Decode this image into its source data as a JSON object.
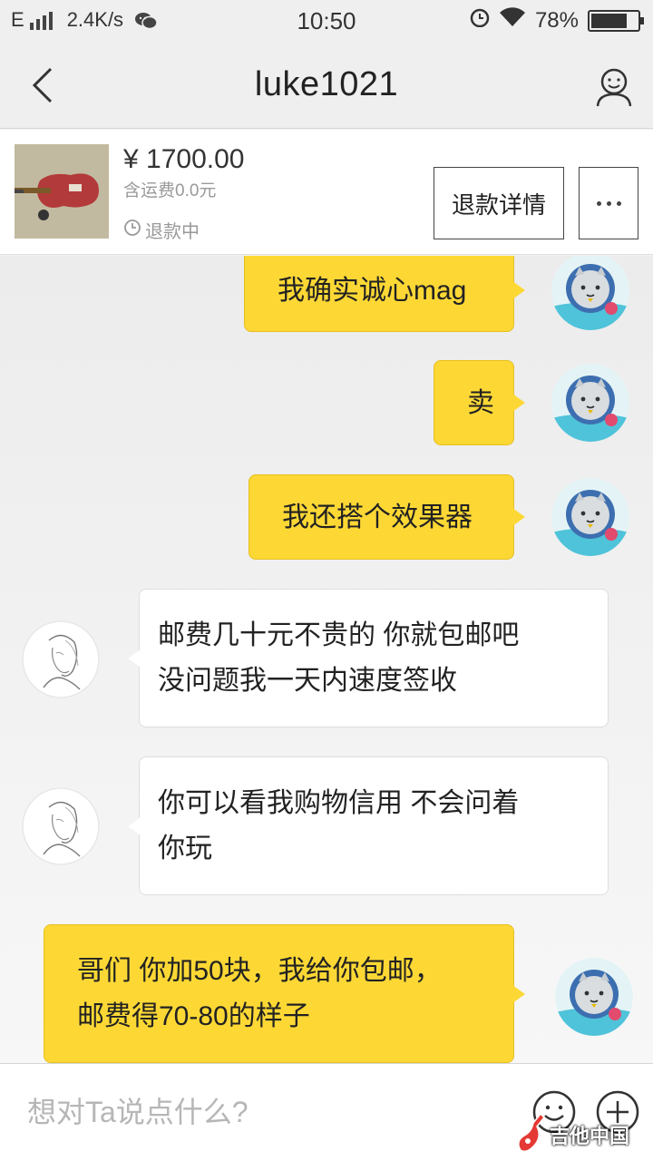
{
  "status_bar": {
    "network": "E",
    "speed": "2.4K/s",
    "time": "10:50",
    "battery": "78%",
    "battery_level": 0.78,
    "icons": [
      "signal-icon",
      "wechat-icon",
      "alarm-icon",
      "wifi-icon",
      "battery-icon"
    ]
  },
  "header": {
    "title": "luke1021",
    "back_icon": "chevron-left-icon",
    "profile_icon": "user-profile-icon"
  },
  "product": {
    "price": "¥ 1700.00",
    "shipping": "含运费0.0元",
    "status": "退款中",
    "refund_button": "退款详情"
  },
  "messages": [
    {
      "sender": "me",
      "lines": [
        "我确实诚心mag"
      ]
    },
    {
      "sender": "me",
      "lines": [
        "卖"
      ]
    },
    {
      "sender": "me",
      "lines": [
        "我还搭个效果器"
      ]
    },
    {
      "sender": "them",
      "lines": [
        "邮费几十元不贵的  你就包邮吧",
        "没问题我一天内速度签收"
      ]
    },
    {
      "sender": "them",
      "lines": [
        "你可以看我购物信用  不会问着",
        "你玩"
      ]
    },
    {
      "sender": "me",
      "lines": [
        "哥们 你加50块，我给你包邮，",
        "邮费得70-80的样子"
      ]
    }
  ],
  "input": {
    "placeholder": "想对Ta说点什么?"
  },
  "watermark": {
    "text": "吉他中国"
  },
  "colors": {
    "bubble_me": "#fdd835",
    "bubble_them": "#ffffff",
    "background": "#f2f2f2"
  }
}
